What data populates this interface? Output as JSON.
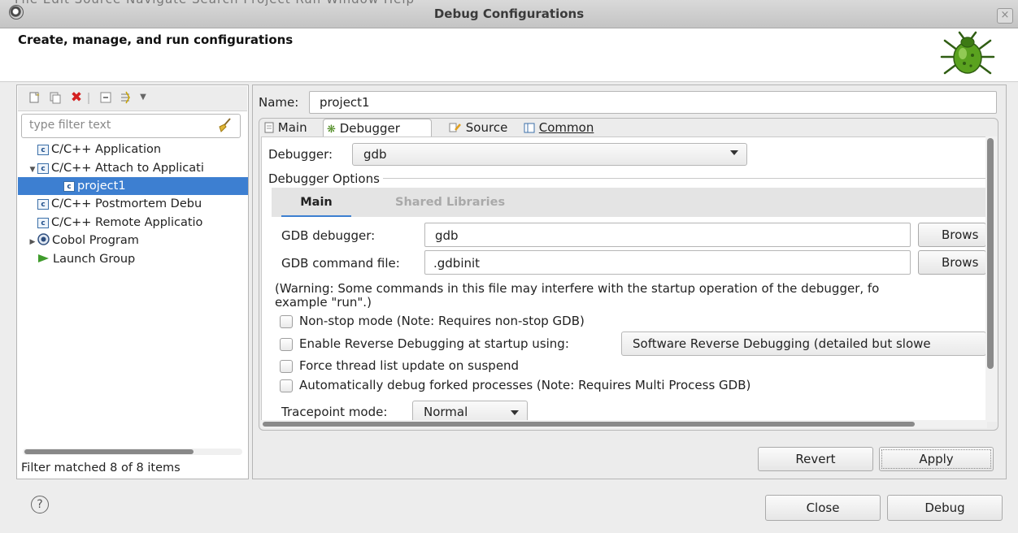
{
  "window": {
    "title": "Debug Configurations",
    "menu_ghost": "File   Edit   Source   Navigate   Search   Project   Run   Window   Help",
    "close_glyph": "×"
  },
  "header": {
    "title": "Create, manage, and run configurations"
  },
  "left": {
    "filter_placeholder": "type filter text",
    "tree": [
      {
        "label": "C/C++ Application",
        "icon": "c",
        "level": 0,
        "twisty": ""
      },
      {
        "label": "C/C++ Attach to Applicati",
        "icon": "c",
        "level": 0,
        "twisty": "▼"
      },
      {
        "label": "project1",
        "icon": "c",
        "level": 1,
        "twisty": "",
        "selected": true
      },
      {
        "label": "C/C++ Postmortem Debu",
        "icon": "c",
        "level": 0,
        "twisty": ""
      },
      {
        "label": "C/C++ Remote Applicatio",
        "icon": "c",
        "level": 0,
        "twisty": ""
      },
      {
        "label": "Cobol Program",
        "icon": "cobol",
        "level": 0,
        "twisty": "▶"
      },
      {
        "label": "Launch Group",
        "icon": "launch",
        "level": 0,
        "twisty": ""
      }
    ],
    "status": "Filter matched 8 of 8 items"
  },
  "right": {
    "name_label": "Name:",
    "name_value": "project1",
    "tabs": [
      {
        "label": "Main",
        "icon": "document-icon"
      },
      {
        "label": "Debugger",
        "icon": "bug-settings-icon",
        "active": true
      },
      {
        "label": "Source",
        "icon": "source-icon"
      },
      {
        "label": "Common",
        "icon": "common-icon"
      }
    ],
    "debugger_label": "Debugger:",
    "debugger_value": "gdb",
    "options_group": "Debugger Options",
    "inner_tabs": {
      "main": "Main",
      "shared": "Shared Libraries"
    },
    "gdb_debugger_label": "GDB debugger:",
    "gdb_debugger_value": "gdb",
    "gdb_command_label": "GDB command file:",
    "gdb_command_value": ".gdbinit",
    "browse_label": "Brows",
    "warning_line1": "(Warning: Some commands in this file may interfere with the startup operation of the debugger, fo",
    "warning_line2": "example \"run\".)",
    "checkboxes": {
      "non_stop": "Non-stop mode (Note: Requires non-stop GDB)",
      "reverse": "Enable Reverse Debugging at startup using:",
      "force_thread": "Force thread list update on suspend",
      "auto_fork": "Automatically debug forked processes (Note: Requires Multi Process GDB)"
    },
    "reverse_combo_value": "Software Reverse Debugging (detailed but slowe",
    "tracepoint_label": "Tracepoint mode:",
    "tracepoint_value": "Normal",
    "revert_label": "Revert",
    "apply_label": "Apply"
  },
  "footer": {
    "help_glyph": "?",
    "close_label": "Close",
    "debug_label": "Debug"
  }
}
